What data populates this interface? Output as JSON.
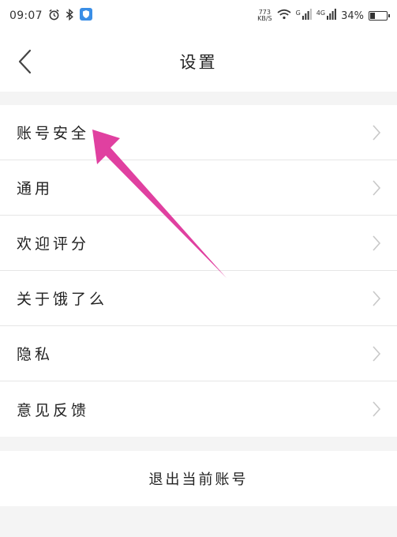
{
  "status_bar": {
    "time": "09:07",
    "speed_value": "773",
    "speed_unit": "KB/S",
    "sim1_label": "G",
    "sim2_label": "4G",
    "battery_percent": "34%",
    "battery_level": 0.34
  },
  "header": {
    "title": "设置"
  },
  "settings": {
    "items": [
      {
        "label": "账号安全"
      },
      {
        "label": "通用"
      },
      {
        "label": "欢迎评分"
      },
      {
        "label": "关于饿了么"
      },
      {
        "label": "隐私"
      },
      {
        "label": "意见反馈"
      }
    ]
  },
  "logout": {
    "label": "退出当前账号"
  },
  "colors": {
    "annotation_arrow": "#e040a0",
    "chevron": "#c8c8c8"
  }
}
